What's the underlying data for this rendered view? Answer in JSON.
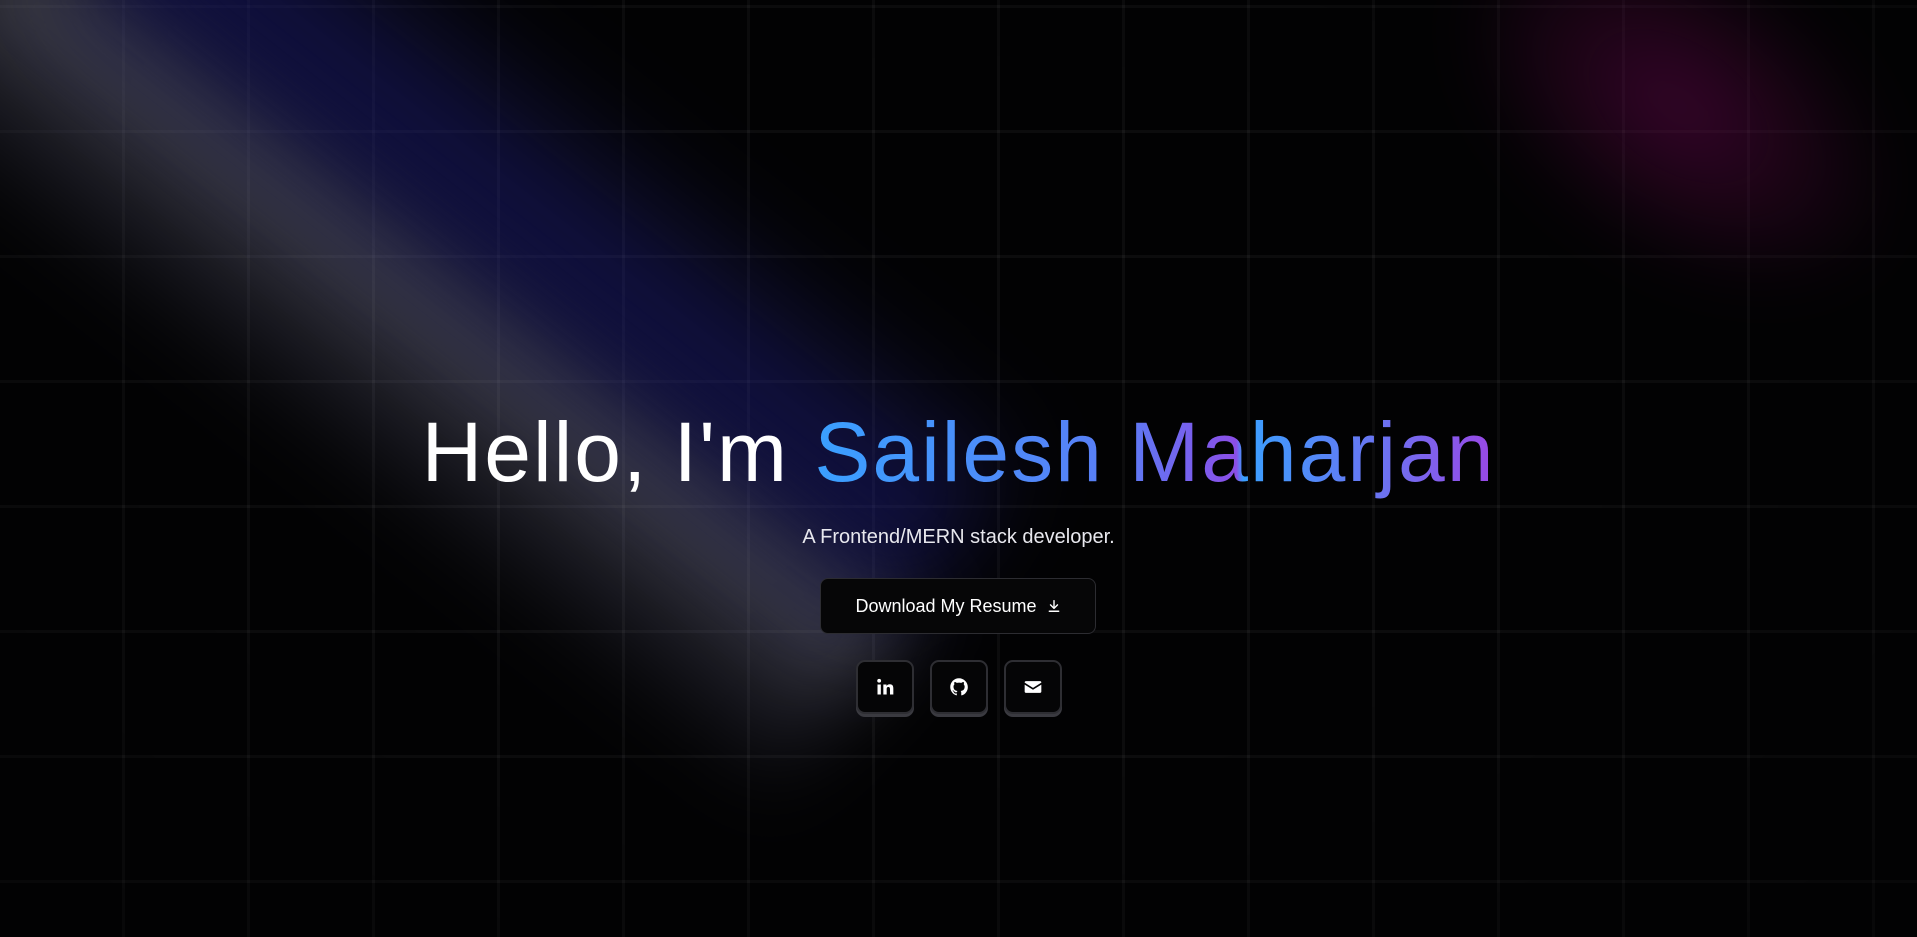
{
  "hero": {
    "greeting": "Hello, I'm",
    "first_name": "Sailesh",
    "last_name": "Maharjan",
    "subtitle": "A Frontend/MERN stack developer.",
    "resume_button_label": "Download My Resume",
    "resume_icon": "download-icon"
  },
  "socials": [
    {
      "icon": "linkedin-icon",
      "label": "LinkedIn"
    },
    {
      "icon": "github-icon",
      "label": "GitHub"
    },
    {
      "icon": "mail-icon",
      "label": "Email"
    }
  ],
  "colors": {
    "background": "#020203",
    "text": "#ffffff",
    "name_gradient_start": "#3aa0ff",
    "name_gradient_end": "#9a47e6",
    "beam_blue": "#1a1a8c",
    "beam_magenta": "#780a5a"
  }
}
